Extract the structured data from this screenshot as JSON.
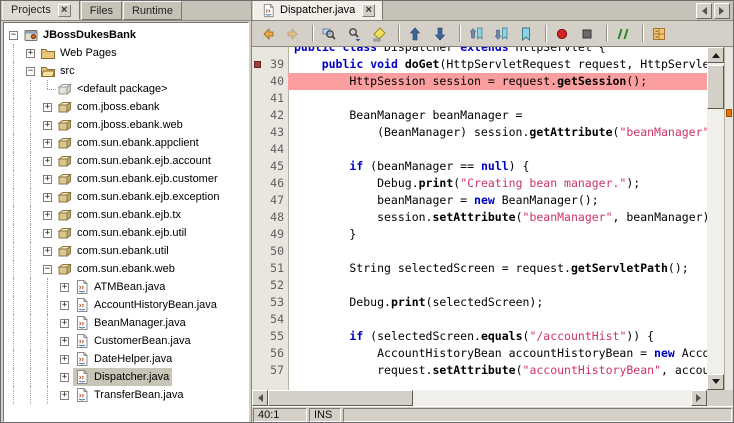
{
  "colors": {
    "chrome": "#d4d0c8",
    "keyword": "#0000c6",
    "string": "#ce3264",
    "breakpoint_line": "#fb9ea0",
    "tree_selection": "#c9c5b6",
    "gutter_bg": "#e8e6de",
    "line_number": "#5f5f5f",
    "error_stripe_mark": "#e87400"
  },
  "left_panel": {
    "tabs": [
      {
        "label": "Projects",
        "active": true,
        "closable": true
      },
      {
        "label": "Files",
        "active": false
      },
      {
        "label": "Runtime",
        "active": false
      }
    ],
    "tree": [
      {
        "depth": 0,
        "handle": "minus",
        "icon": "project-icon",
        "label": "JBossDukesBank",
        "bold": true
      },
      {
        "depth": 1,
        "handle": "plus",
        "icon": "folder-icon",
        "label": "Web Pages"
      },
      {
        "depth": 1,
        "handle": "minus",
        "icon": "folder-open-icon",
        "label": "src"
      },
      {
        "depth": 2,
        "handle": "none",
        "icon": "package-empty-icon",
        "label": "<default package>"
      },
      {
        "depth": 2,
        "handle": "plus",
        "icon": "package-icon",
        "label": "com.jboss.ebank"
      },
      {
        "depth": 2,
        "handle": "plus",
        "icon": "package-icon",
        "label": "com.jboss.ebank.web"
      },
      {
        "depth": 2,
        "handle": "plus",
        "icon": "package-icon",
        "label": "com.sun.ebank.appclient"
      },
      {
        "depth": 2,
        "handle": "plus",
        "icon": "package-icon",
        "label": "com.sun.ebank.ejb.account"
      },
      {
        "depth": 2,
        "handle": "plus",
        "icon": "package-icon",
        "label": "com.sun.ebank.ejb.customer"
      },
      {
        "depth": 2,
        "handle": "plus",
        "icon": "package-icon",
        "label": "com.sun.ebank.ejb.exception"
      },
      {
        "depth": 2,
        "handle": "plus",
        "icon": "package-icon",
        "label": "com.sun.ebank.ejb.tx"
      },
      {
        "depth": 2,
        "handle": "plus",
        "icon": "package-icon",
        "label": "com.sun.ebank.ejb.util"
      },
      {
        "depth": 2,
        "handle": "plus",
        "icon": "package-icon",
        "label": "com.sun.ebank.util"
      },
      {
        "depth": 2,
        "handle": "minus",
        "icon": "package-icon",
        "label": "com.sun.ebank.web"
      },
      {
        "depth": 3,
        "handle": "plus",
        "icon": "java-file-icon",
        "label": "ATMBean.java"
      },
      {
        "depth": 3,
        "handle": "plus",
        "icon": "java-file-icon",
        "label": "AccountHistoryBean.java"
      },
      {
        "depth": 3,
        "handle": "plus",
        "icon": "java-file-icon",
        "label": "BeanManager.java"
      },
      {
        "depth": 3,
        "handle": "plus",
        "icon": "java-file-icon",
        "label": "CustomerBean.java"
      },
      {
        "depth": 3,
        "handle": "plus",
        "icon": "java-file-icon",
        "label": "DateHelper.java"
      },
      {
        "depth": 3,
        "handle": "plus",
        "icon": "java-file-icon",
        "label": "Dispatcher.java",
        "selected": true
      },
      {
        "depth": 3,
        "handle": "plus",
        "icon": "java-file-icon",
        "label": "TransferBean.java"
      }
    ]
  },
  "editor": {
    "tab": {
      "label": "Dispatcher.java",
      "closable": true
    },
    "toolbar": [
      "back",
      "forward",
      "|",
      "find-selection",
      "find-next",
      "toggle-highlight-search",
      "|",
      "previous-occurrence",
      "next-occurrence",
      "|",
      "previous-bookmark",
      "next-bookmark",
      "toggle-bookmark",
      "|",
      "start-macro-recording",
      "stop-macro-recording",
      "|",
      "comment-lines",
      "|",
      "code-folding-menu"
    ],
    "status": {
      "caret": "40:1",
      "mode": "INS",
      "message": ""
    },
    "error_stripe": {
      "marks": [
        {
          "color": "#e87400"
        }
      ]
    },
    "code_lines": [
      {
        "num": "",
        "partial": true,
        "segments": [
          [
            "k",
            "public"
          ],
          [
            "p",
            " "
          ],
          [
            "k",
            "class"
          ],
          [
            "p",
            " Dispatcher "
          ],
          [
            "k",
            "extends"
          ],
          [
            "p",
            " HttpServlet {"
          ]
        ]
      },
      {
        "num": "39",
        "glyph": true,
        "segments": [
          [
            "p",
            "    "
          ],
          [
            "k",
            "public"
          ],
          [
            "p",
            " "
          ],
          [
            "k",
            "void"
          ],
          [
            "p",
            " "
          ],
          [
            "m",
            "doGet"
          ],
          [
            "p",
            "(HttpServletRequest request, HttpServletResponse response)"
          ]
        ]
      },
      {
        "num": "40",
        "highlight": true,
        "segments": [
          [
            "p",
            "        HttpSession session = request."
          ],
          [
            "m",
            "getSession"
          ],
          [
            "p",
            "();"
          ]
        ]
      },
      {
        "num": "41",
        "segments": []
      },
      {
        "num": "42",
        "segments": [
          [
            "p",
            "        BeanManager beanManager ="
          ]
        ]
      },
      {
        "num": "43",
        "segments": [
          [
            "p",
            "            (BeanManager) session."
          ],
          [
            "m",
            "getAttribute"
          ],
          [
            "p",
            "("
          ],
          [
            "s",
            "\"beanManager\""
          ],
          [
            "p",
            ");"
          ]
        ]
      },
      {
        "num": "44",
        "segments": []
      },
      {
        "num": "45",
        "segments": [
          [
            "p",
            "        "
          ],
          [
            "k",
            "if"
          ],
          [
            "p",
            " (beanManager == "
          ],
          [
            "k",
            "null"
          ],
          [
            "p",
            ") {"
          ]
        ]
      },
      {
        "num": "46",
        "segments": [
          [
            "p",
            "            Debug."
          ],
          [
            "m",
            "print"
          ],
          [
            "p",
            "("
          ],
          [
            "s",
            "\"Creating bean manager.\""
          ],
          [
            "p",
            ");"
          ]
        ]
      },
      {
        "num": "47",
        "segments": [
          [
            "p",
            "            beanManager = "
          ],
          [
            "k",
            "new"
          ],
          [
            "p",
            " BeanManager();"
          ]
        ]
      },
      {
        "num": "48",
        "segments": [
          [
            "p",
            "            session."
          ],
          [
            "m",
            "setAttribute"
          ],
          [
            "p",
            "("
          ],
          [
            "s",
            "\"beanManager\""
          ],
          [
            "p",
            ", beanManager);"
          ]
        ]
      },
      {
        "num": "49",
        "segments": [
          [
            "p",
            "        }"
          ]
        ]
      },
      {
        "num": "50",
        "segments": []
      },
      {
        "num": "51",
        "segments": [
          [
            "p",
            "        String selectedScreen = request."
          ],
          [
            "m",
            "getServletPath"
          ],
          [
            "p",
            "();"
          ]
        ]
      },
      {
        "num": "52",
        "segments": []
      },
      {
        "num": "53",
        "segments": [
          [
            "p",
            "        Debug."
          ],
          [
            "m",
            "print"
          ],
          [
            "p",
            "(selectedScreen);"
          ]
        ]
      },
      {
        "num": "54",
        "segments": []
      },
      {
        "num": "55",
        "segments": [
          [
            "p",
            "        "
          ],
          [
            "k",
            "if"
          ],
          [
            "p",
            " (selectedScreen."
          ],
          [
            "m",
            "equals"
          ],
          [
            "p",
            "("
          ],
          [
            "s",
            "\"/accountHist\""
          ],
          [
            "p",
            ")) {"
          ]
        ]
      },
      {
        "num": "56",
        "segments": [
          [
            "p",
            "            AccountHistoryBean accountHistoryBean = "
          ],
          [
            "k",
            "new"
          ],
          [
            "p",
            " AccountHistoryBean();"
          ]
        ]
      },
      {
        "num": "57",
        "segments": [
          [
            "p",
            "            request."
          ],
          [
            "m",
            "setAttribute"
          ],
          [
            "p",
            "("
          ],
          [
            "s",
            "\"accountHistoryBean\""
          ],
          [
            "p",
            ", accountHistoryBean);"
          ]
        ]
      }
    ]
  }
}
